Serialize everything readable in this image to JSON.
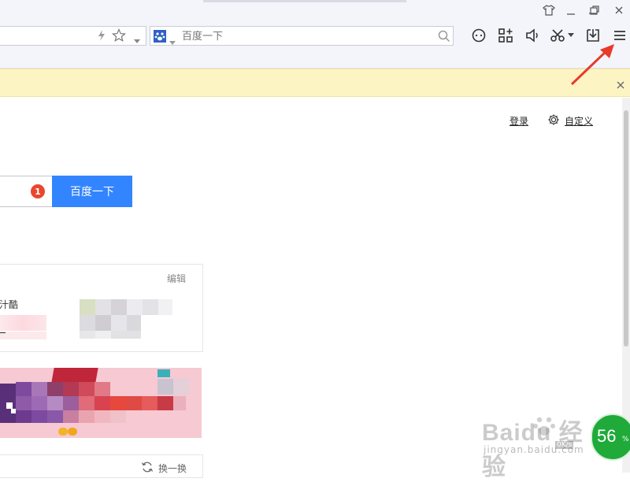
{
  "toolbar": {
    "search_placeholder": "百度一下"
  },
  "page": {
    "login_link": "登录",
    "customize_link": "自定义",
    "search_button": "百度一下",
    "badge_count": "1",
    "card1": {
      "edit_label": "编辑",
      "partial_text": "汁酷"
    },
    "card2": {
      "refresh_label": "换一换"
    }
  },
  "watermark": {
    "text": "Baidu 经验",
    "url": "jingyan.baidu.com"
  },
  "speed_widget": {
    "percent": "56",
    "percent_sign": "%",
    "rate": "0K/s"
  },
  "colors": {
    "accent": "#3385ff",
    "notice_bg": "#fdf4c4",
    "arrow": "#e8392b",
    "badge": "#e8472e",
    "speed_widget": "#1faa3a"
  }
}
